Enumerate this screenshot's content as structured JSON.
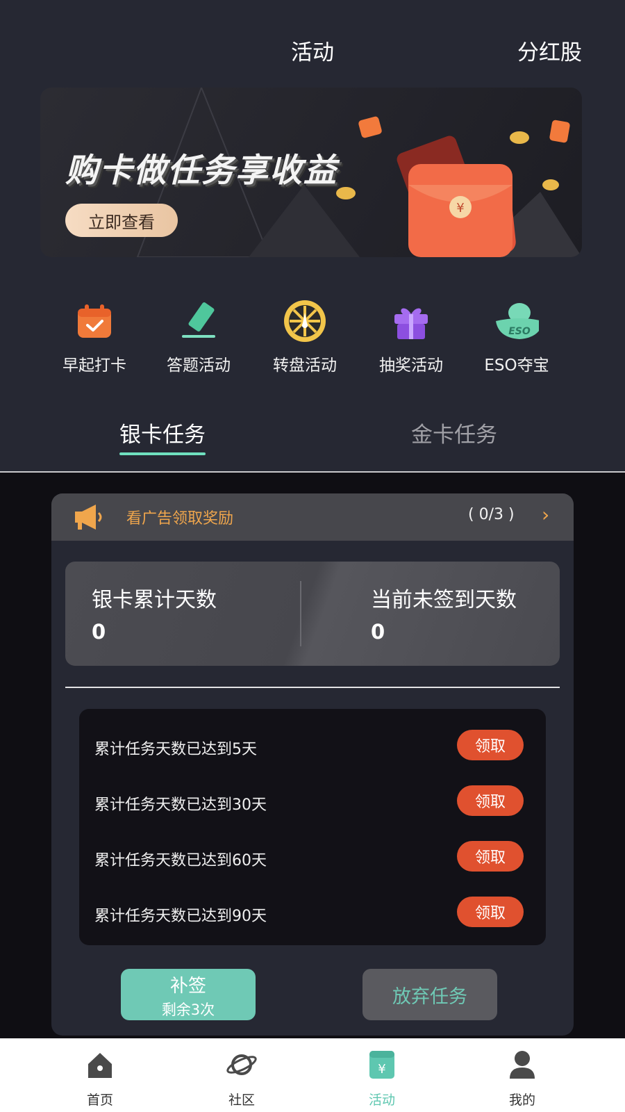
{
  "header": {
    "title": "活动",
    "right_label": "分红股"
  },
  "banner": {
    "title": "购卡做任务享收益",
    "button_label": "立即查看"
  },
  "activities": [
    {
      "label": "早起打卡",
      "icon": "calendar-check-icon"
    },
    {
      "label": "答题活动",
      "icon": "pen-icon"
    },
    {
      "label": "转盘活动",
      "icon": "wheel-icon"
    },
    {
      "label": "抽奖活动",
      "icon": "gift-icon"
    },
    {
      "label": "ESO夺宝",
      "icon": "ingot-icon",
      "icon_text": "ESO"
    }
  ],
  "tabs": [
    {
      "label": "银卡任务",
      "active": true
    },
    {
      "label": "金卡任务",
      "active": false
    }
  ],
  "ad": {
    "text": "看广告领取奖励",
    "count": "( 0/3 )"
  },
  "stats": {
    "left": {
      "label": "银卡累计天数",
      "value": "0"
    },
    "right": {
      "label": "当前未签到天数",
      "value": "0"
    }
  },
  "rewards": [
    {
      "text": "累计任务天数已达到5天",
      "button": "领取"
    },
    {
      "text": "累计任务天数已达到30天",
      "button": "领取"
    },
    {
      "text": "累计任务天数已达到60天",
      "button": "领取"
    },
    {
      "text": "累计任务天数已达到90天",
      "button": "领取"
    }
  ],
  "actions": {
    "resign_label": "补签",
    "resign_remaining": "剩余3次",
    "abandon_label": "放弃任务"
  },
  "nav": [
    {
      "label": "首页",
      "icon": "home-icon",
      "active": false
    },
    {
      "label": "社区",
      "icon": "planet-icon",
      "active": false
    },
    {
      "label": "活动",
      "icon": "activity-icon",
      "active": true,
      "icon_text": "¥"
    },
    {
      "label": "我的",
      "icon": "user-icon",
      "active": false
    }
  ],
  "colors": {
    "accent": "#6fe0bf",
    "reward_button": "#e0512f",
    "ad_text": "#f0a64c",
    "background": "#262833"
  }
}
